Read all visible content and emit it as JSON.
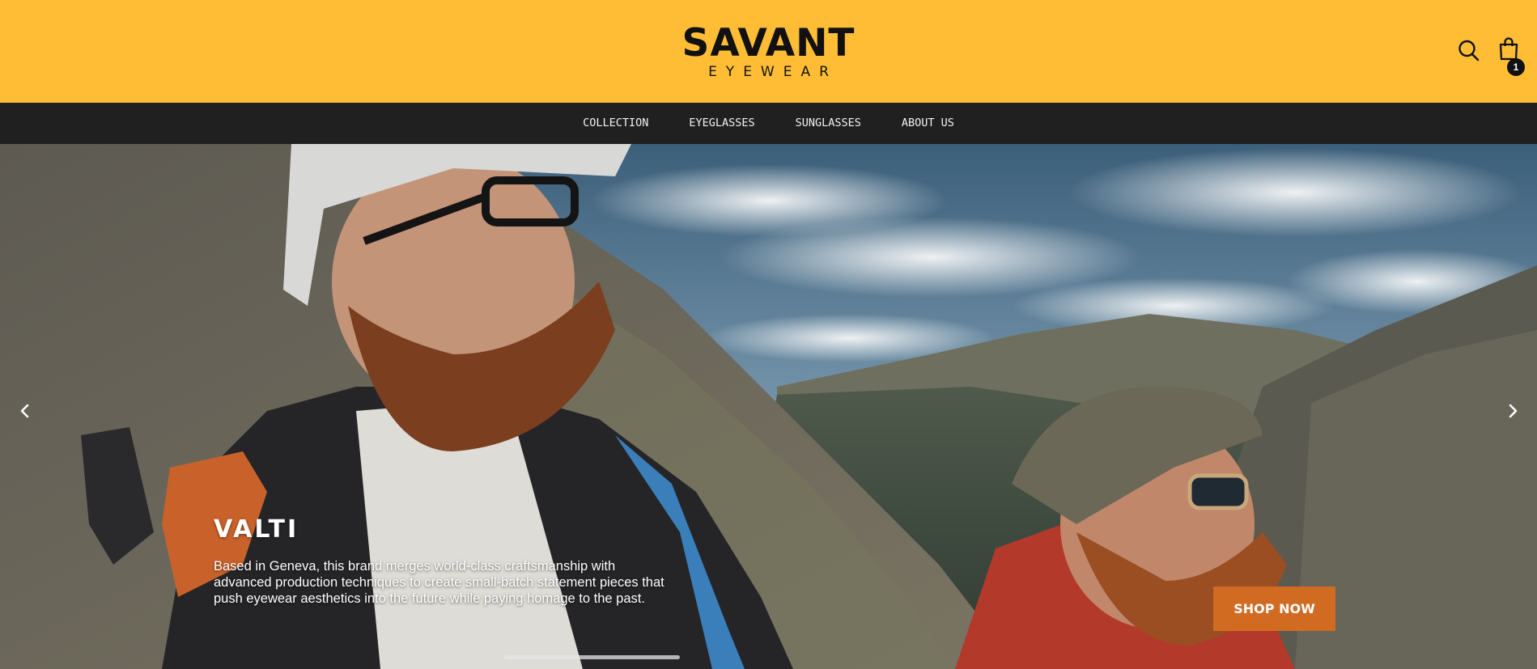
{
  "header": {
    "logo_main": "SAVANT",
    "logo_sub": "EYEWEAR",
    "background": "#ffbd35",
    "icons": [
      "search-icon",
      "shopping-bag-icon"
    ],
    "cart_count": "1"
  },
  "nav": {
    "background": "#202020",
    "items": [
      {
        "label": "COLLECTION"
      },
      {
        "label": "EYEGLASSES"
      },
      {
        "label": "SUNGLASSES"
      },
      {
        "label": "ABOUT US"
      }
    ]
  },
  "hero": {
    "title": "VALTI",
    "description": "Based in Geneva, this brand merges world-class craftsmanship with advanced production techniques to create small-batch statement pieces that push eyewear aesthetics into the future while paying homage to the past.",
    "cta_label": "SHOP NOW",
    "cta_color": "#d16b22",
    "prev_icon": "chevron-left-icon",
    "next_icon": "chevron-right-icon"
  }
}
